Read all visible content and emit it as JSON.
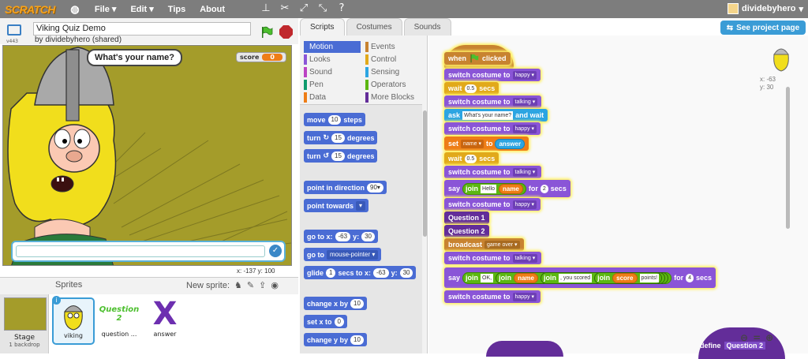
{
  "topbar": {
    "logo": "SCRATCH",
    "menus": [
      "File ▾",
      "Edit ▾",
      "Tips",
      "About"
    ],
    "user": "dividebyhero"
  },
  "project": {
    "title": "Viking Quiz Demo",
    "byline": "by dividebyhero (shared)",
    "version": "v443"
  },
  "stage": {
    "score_label": "score",
    "score_value": "0",
    "speech": "What's your name?",
    "mouse": "x: -137  y: 100",
    "check": "✓"
  },
  "sprites": {
    "header": "Sprites",
    "new_sprite": "New sprite:",
    "stage_label": "Stage",
    "stage_sub": "1 backdrop",
    "items": [
      "viking",
      "question ...",
      "answer"
    ],
    "q2_text": "Question 2",
    "answer_glyph": "X"
  },
  "tabs": [
    "Scripts",
    "Costumes",
    "Sounds"
  ],
  "categories": {
    "motion": "Motion",
    "looks": "Looks",
    "sound": "Sound",
    "pen": "Pen",
    "data": "Data",
    "events": "Events",
    "control": "Control",
    "sensing": "Sensing",
    "operators": "Operators",
    "more": "More Blocks"
  },
  "palette": {
    "move": "move",
    "move_v": "10",
    "steps": "steps",
    "turn": "turn",
    "turn_cw": "↻",
    "turn_ccw": "↺",
    "turn_v": "15",
    "degrees": "degrees",
    "point_dir": "point in direction",
    "point_dir_v": "90▾",
    "point_towards": "point towards",
    "point_towards_v": "▾",
    "goto_xy": "go to x:",
    "gx": "-63",
    "y": "y:",
    "gy": "30",
    "goto": "go to",
    "goto_v": "mouse-pointer ▾",
    "glide": "glide",
    "glide_v": "1",
    "secs_to_x": "secs to x:",
    "glx": "-63",
    "gly": "30",
    "change_x": "change x by",
    "change_x_v": "10",
    "set_x": "set x to",
    "set_x_v": "0",
    "change_y": "change y by",
    "change_y_v": "10"
  },
  "script": {
    "when": "when",
    "clicked": "clicked",
    "switch": "switch costume to",
    "happy": "happy ▾",
    "talking": "talking ▾",
    "wait": "wait",
    "secs": "secs",
    "w05": "0.5",
    "ask": "ask",
    "ask_v": "What's your name?",
    "and_wait": "and wait",
    "set": "set",
    "name_dd": "name ▾",
    "to": "to",
    "answer": "answer",
    "say": "say",
    "join": "join",
    "hello": "Hello",
    "name": "name",
    "for": "for",
    "two": "2",
    "q1": "Question 1",
    "q2": "Question 2",
    "broadcast": "broadcast",
    "game_over": "game over ▾",
    "ok": "OK,",
    ", you scored": ", you scored",
    "score": "score",
    "points": "points!",
    "four": "4"
  },
  "corner": {
    "x": "x: -63",
    "y": "y: 30"
  },
  "zoom": {
    "out": "⊖",
    "reset": "=",
    "in": "⊕"
  },
  "see_project": "See project page",
  "define": {
    "label": "define",
    "name": "Question 2"
  },
  "colors": {
    "motion": "#4a6cd4",
    "looks": "#8a55d7",
    "sound": "#bb42c3",
    "pen": "#0e9a6c",
    "data": "#ee7d16",
    "events": "#c88330",
    "control": "#e1a91a",
    "sensing": "#2ca5e2",
    "operators": "#5cb712",
    "more": "#632d99"
  }
}
